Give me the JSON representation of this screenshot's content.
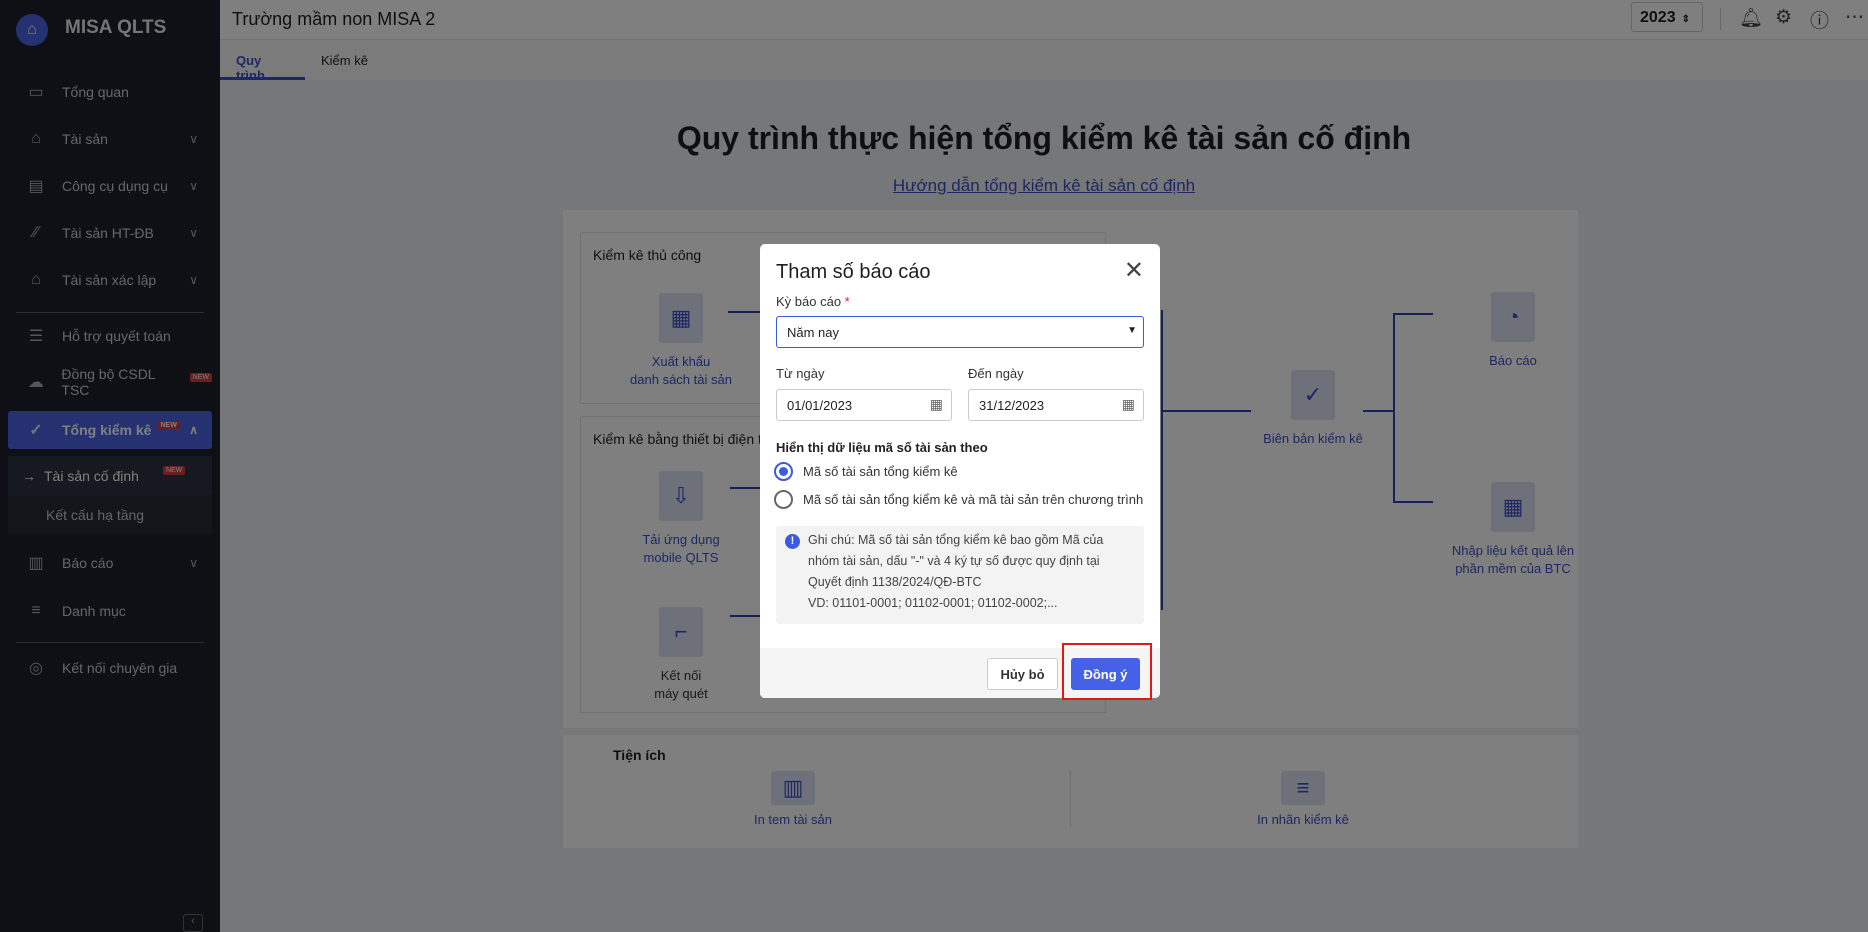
{
  "app": {
    "brand": "MISA QLTS",
    "school": "Trường mầm non MISA 2",
    "year": "2023"
  },
  "sidebar": {
    "items": [
      {
        "label": "Tổng quan",
        "icon": "monitor-icon"
      },
      {
        "label": "Tài sản",
        "icon": "car-house-icon"
      },
      {
        "label": "Công cụ dụng cụ",
        "icon": "paint-roller-icon"
      },
      {
        "label": "Tài sản HT-ĐB",
        "icon": "road-icon"
      },
      {
        "label": "Tài sản xác lập",
        "icon": "car-house-icon"
      },
      {
        "label": "Hỗ trợ quyết toán",
        "icon": "clipboard-icon"
      },
      {
        "label": "Đồng bộ CSDL TSC",
        "icon": "cloud-upload-icon",
        "badge": "NEW"
      },
      {
        "label": "Tổng kiểm kê",
        "icon": "doc-check-icon",
        "badge": "NEW"
      },
      {
        "label": "Báo cáo",
        "icon": "chart-icon"
      },
      {
        "label": "Danh mục",
        "icon": "list-icon"
      },
      {
        "label": "Kết nối chuyên gia",
        "icon": "expert-icon"
      }
    ],
    "sub": [
      {
        "label": "Tài sản cố định",
        "badge": "NEW"
      },
      {
        "label": "Kết cấu hạ tầng"
      }
    ]
  },
  "tabs": [
    "Quy trình",
    "Kiểm kê"
  ],
  "main": {
    "title": "Quy trình thực hiện tổng kiểm kê tài sản cố định",
    "guide": "Hướng dẫn tổng kiểm kê tài sản cố định",
    "manual": {
      "title": "Kiểm kê thủ công",
      "step": [
        "Xuất khẩu",
        "danh sách tài sản"
      ]
    },
    "device": {
      "title": "Kiểm kê bằng thiết bị điện tử",
      "app": [
        "Tải ứng dụng",
        "mobile QLTS"
      ],
      "scanner": [
        "Kết nối",
        "máy quét"
      ]
    },
    "record": "Biên bản kiểm kê",
    "report": "Báo cáo",
    "import": [
      "Nhập liệu kết quả lên",
      "phần mềm của BTC"
    ],
    "utilities": {
      "title": "Tiện ích",
      "items": [
        "In tem tài sản",
        "In nhãn kiểm kê"
      ]
    }
  },
  "modal": {
    "title": "Tham số báo cáo",
    "period_label": "Kỳ báo cáo",
    "required": "*",
    "period": "Năm nay",
    "from_label": "Từ ngày",
    "from": "01/01/2023",
    "to_label": "Đến ngày",
    "to": "31/12/2023",
    "display_label": "Hiển thị dữ liệu mã số tài sản theo",
    "options": [
      "Mã số tài sản tổng kiểm kê",
      "Mã số tài sản tổng kiểm kê và mã tài sản trên chương trình"
    ],
    "selected_option": 0,
    "note": [
      "Ghi chú: Mã số tài sản tổng kiểm kê bao gồm Mã của",
      "nhóm tài sản, dấu \"-\" và 4 ký tự số được quy định tại",
      "Quyết định 1138/2024/QĐ-BTC",
      "VD: 01101-0001; 01102-0001; 01102-0002;..."
    ],
    "cancel": "Hủy bỏ",
    "ok": "Đồng ý"
  }
}
